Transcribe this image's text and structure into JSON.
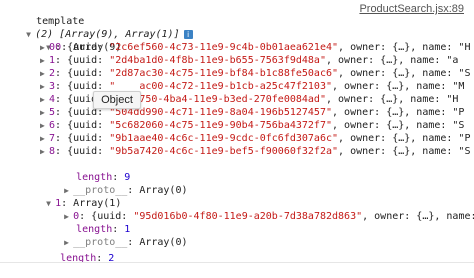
{
  "header": {
    "label": "template",
    "source_link": "ProductSearch.jsx:89"
  },
  "root": {
    "summary": "(2) [Array(9), Array(1)]",
    "info_icon": "i"
  },
  "group0": {
    "label": "0",
    "type": "Array(9)",
    "rows": [
      {
        "i": "0",
        "uuid": "\"2c6ef560-4c73-11e9-9c4b-0b01aea621e4\"",
        "owner": "owner: {…}, name: \"H",
        "tail": ""
      },
      {
        "i": "1",
        "uuid": "\"2d4ba1d0-4f8b-11e9-b655-7563f9d48a\"",
        "owner": "owner: {…}, name: \"a",
        "tail": ""
      },
      {
        "i": "2",
        "uuid": "\"2d87ac30-4c75-11e9-bf84-b1c88fe50ac6\"",
        "owner": "owner: {…}, name: \"S",
        "tail": ""
      },
      {
        "i": "3",
        "uuid": "\"    ac00-4c72-11e9-b1cb-a25c47f2103\"",
        "owner": "owner: {…}, name: \"M",
        "tail": ""
      },
      {
        "i": "4",
        "uuid": "\"   c750-4ba4-11e9-b3ed-270fe0084ad\"",
        "owner": "owner: {…}, name: \"H",
        "tail": ""
      },
      {
        "i": "5",
        "uuid": "\"504dd990-4c71-11e9-8a04-196b5127457\"",
        "owner": "owner: {…}, name: \"P",
        "tail": ""
      },
      {
        "i": "6",
        "uuid": "\"5c682060-4c75-11e9-90b4-756ba4372f7\"",
        "owner": "owner: {…}, name: \"S",
        "tail": ""
      },
      {
        "i": "7",
        "uuid": "\"9b1aae40-4c6c-11e9-9cdc-0fc6fd307a6c\"",
        "owner": "owner: {…}, name: \"P",
        "tail": ""
      },
      {
        "i": "8",
        "uuid": "\"9b5a7420-4c6c-11e9-bef5-f90060f32f2a\"",
        "owner": "owner: {…}, name: \"S",
        "tail": ""
      }
    ],
    "length_key": "length",
    "length_val": "9",
    "proto_key": "__proto__",
    "proto_val": "Array(0)"
  },
  "group1": {
    "label": "1",
    "type": "Array(1)",
    "rows": [
      {
        "i": "0",
        "uuid": "\"95d016b0-4f80-11e9-a20b-7d38a782d863\"",
        "owner": "owner: {…}, name: \"s"
      }
    ],
    "length_key": "length",
    "length_val": "1",
    "proto_key": "__proto__",
    "proto_val": "Array(0)"
  },
  "root_length": {
    "key": "length",
    "val": "2"
  },
  "tooltip": "Object",
  "uuid_key": "{uuid:"
}
